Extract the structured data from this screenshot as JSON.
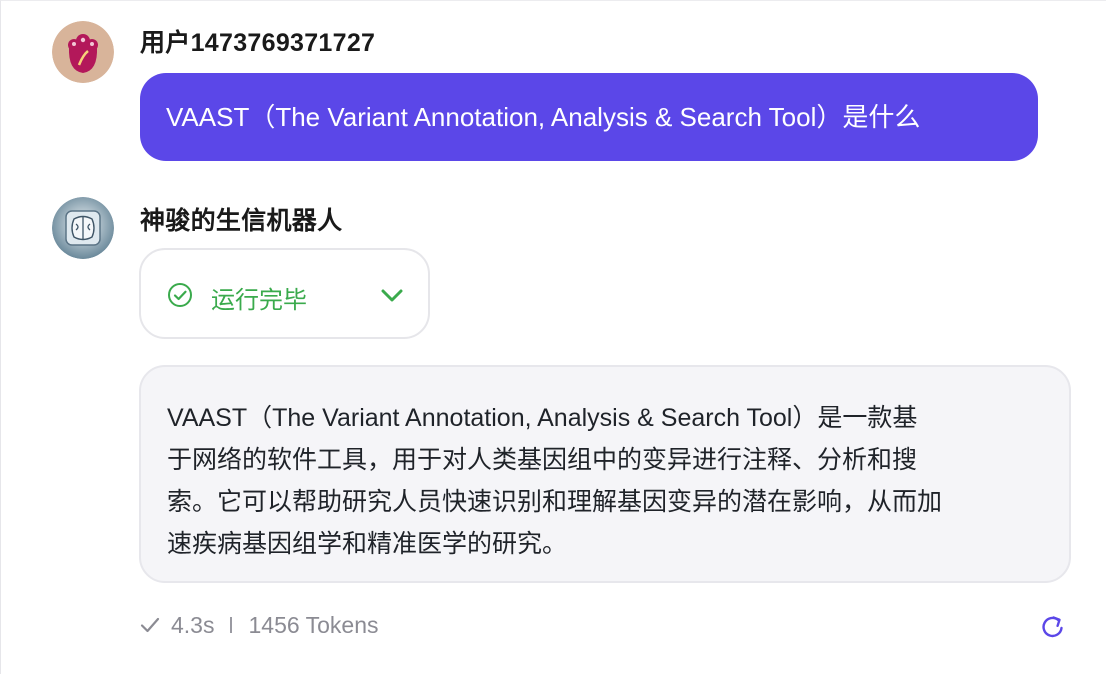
{
  "user_message": {
    "username": "用户1473769371727",
    "text": "VAAST（The Variant Annotation, Analysis & Search Tool）是什么"
  },
  "bot_message": {
    "name": "神骏的生信机器人",
    "status": {
      "label": "运行完毕",
      "icon": "check-circle-icon",
      "expand_icon": "chevron-down-icon"
    },
    "answer_lines": [
      "VAAST（The Variant Annotation, Analysis & Search Tool）是一款基",
      "于网络的软件工具，用于对人类基因组中的变异进行注释、分析和搜",
      "索。它可以帮助研究人员快速识别和理解基因变异的潜在影响，从而加",
      "速疾病基因组学和精准医学的研究。"
    ],
    "meta": {
      "duration": "4.3s",
      "tokens": "1456 Tokens"
    },
    "regenerate_icon": "refresh-icon"
  },
  "colors": {
    "user_bubble": "#5b47e8",
    "status_green": "#3aaa4c",
    "answer_bg": "#f5f5f8",
    "accent": "#5b47e8"
  }
}
